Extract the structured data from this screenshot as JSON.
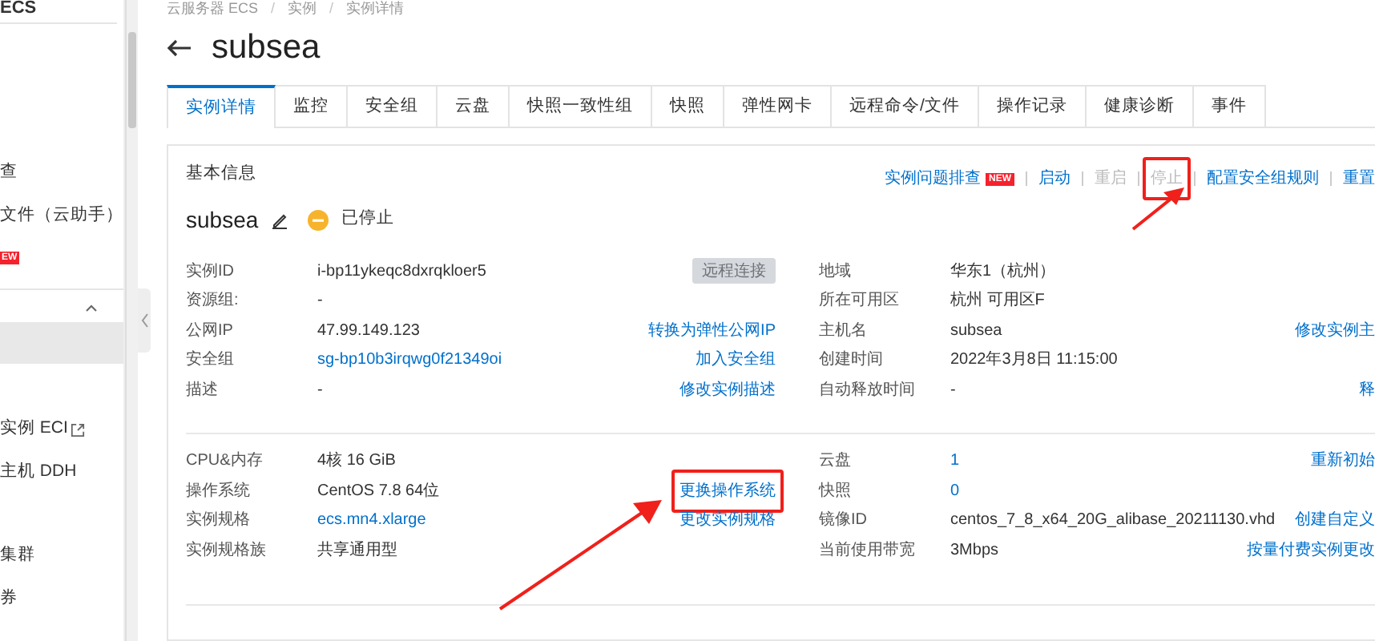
{
  "sidebar": {
    "title": "ECS",
    "sections": [
      {
        "items": [
          {
            "label": "查",
            "selected": false
          },
          {
            "label": "文件（云助手）",
            "selected": false
          },
          {
            "badge": "EW",
            "selected": false
          }
        ]
      },
      {
        "expanded": true,
        "items": [
          {
            "selected": true
          }
        ]
      },
      {
        "items": [
          {
            "label": "实例 ECI",
            "external": true,
            "selected": false
          },
          {
            "label": "主机 DDH",
            "selected": false
          }
        ]
      },
      {
        "items": [
          {
            "label": "集群",
            "selected": false
          },
          {
            "label": "券",
            "selected": false
          }
        ]
      }
    ]
  },
  "breadcrumb": [
    {
      "kind": "link",
      "text": "云服务器 ECS"
    },
    {
      "kind": "separator",
      "text": "/"
    },
    {
      "kind": "link",
      "text": "实例"
    },
    {
      "kind": "separator",
      "text": "/"
    },
    {
      "kind": "link",
      "text": "实例详情"
    }
  ],
  "title": "subsea",
  "tabs": [
    {
      "label": "实例详情",
      "selected": true
    },
    {
      "label": "监控",
      "selected": false
    },
    {
      "label": "安全组",
      "selected": false
    },
    {
      "label": "云盘",
      "selected": false
    },
    {
      "label": "快照一致性组",
      "selected": false
    },
    {
      "label": "快照",
      "selected": false
    },
    {
      "label": "弹性网卡",
      "selected": false
    },
    {
      "label": "远程命令/文件",
      "selected": false
    },
    {
      "label": "操作记录",
      "selected": false
    },
    {
      "label": "健康诊断",
      "selected": false
    },
    {
      "label": "事件",
      "selected": false
    }
  ],
  "card": {
    "heading": "基本信息",
    "actions": [
      {
        "label": "实例问题排查",
        "badge": "NEW",
        "disabled": false
      },
      {
        "label": "启动",
        "disabled": false
      },
      {
        "label": "重启",
        "disabled": true
      },
      {
        "label": "停止",
        "disabled": true,
        "highlighted": true
      },
      {
        "label": "配置安全组规则",
        "disabled": false
      },
      {
        "label": "重置",
        "disabled": false
      }
    ],
    "instance_name": "subsea",
    "status": "已停止",
    "sections": [
      {
        "rows": [
          {
            "label": "实例ID",
            "value": "i-bp11ykeqc8dxrqkloer5",
            "button": {
              "label": "远程连接",
              "disabled": true
            },
            "label_2": "地域",
            "value_2": "华东1（杭州）"
          },
          {
            "label": "资源组:",
            "value": "-",
            "label_2": "所在可用区",
            "value_2": "杭州 可用区F"
          },
          {
            "label": "公网IP",
            "value": "47.99.149.123",
            "action": {
              "label": "转换为弹性公网IP"
            },
            "label_2": "主机名",
            "value_2": "subsea",
            "action_2": "修改实例主"
          },
          {
            "label": "安全组",
            "value": "sg-bp10b3irqwg0f21349oi",
            "value_link": true,
            "action": {
              "label": "加入安全组"
            },
            "label_2": "创建时间",
            "value_2": "2022年3月8日 11:15:00"
          },
          {
            "label": "描述",
            "value": "-",
            "action": {
              "label": "修改实例描述"
            },
            "label_2": "自动释放时间",
            "value_2": "-",
            "action_2": "释"
          }
        ]
      },
      {
        "rows": [
          {
            "label": "CPU&内存",
            "value": "4核 16 GiB",
            "label_2": "云盘",
            "value_2": "1",
            "value_2_link": true,
            "action_2": "重新初始"
          },
          {
            "label": "操作系统",
            "value": "CentOS 7.8 64位",
            "action": {
              "label": "更换操作系统",
              "highlighted": true
            },
            "label_2": "快照",
            "value_2": "0",
            "value_2_link": true
          },
          {
            "label": "实例规格",
            "value": "ecs.mn4.xlarge",
            "value_link": true,
            "action": {
              "label": "更改实例规格"
            },
            "label_2": "镜像ID",
            "value_2": "centos_7_8_x64_20G_alibase_20211130.vhd",
            "action_2": "创建自定义"
          },
          {
            "label": "实例规格族",
            "value": "共享通用型",
            "label_2": "当前使用带宽",
            "value_2": "3Mbps",
            "action_2": "按量付费实例更改"
          }
        ]
      }
    ]
  }
}
